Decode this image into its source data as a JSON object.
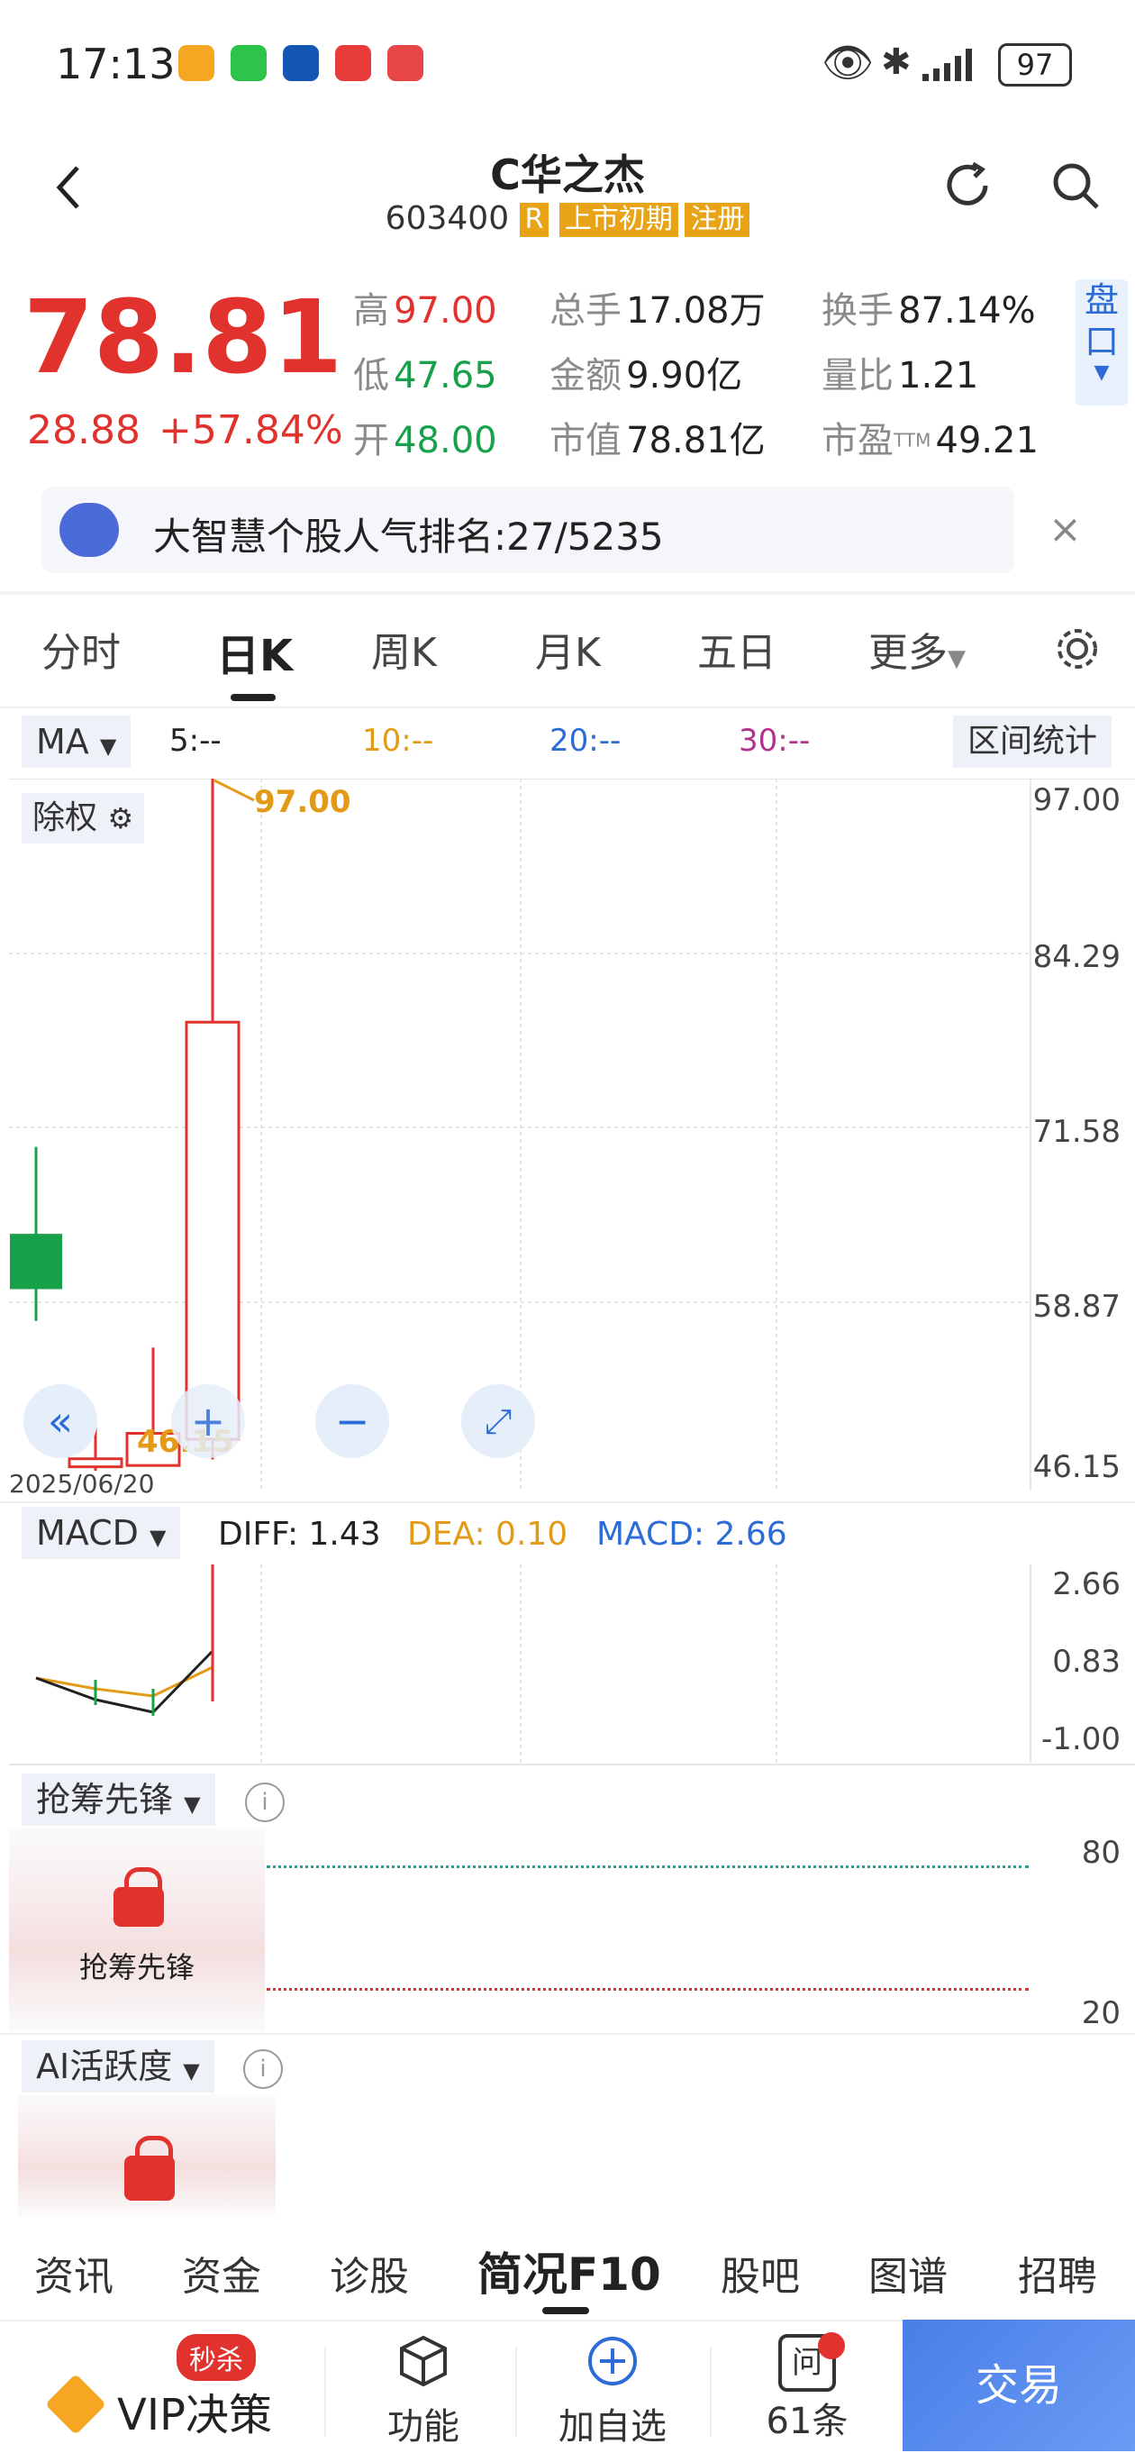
{
  "status_bar": {
    "time": "17:13",
    "battery": "97"
  },
  "header": {
    "title": "C华之杰",
    "code": "603400",
    "tag_r": "R",
    "tag_listing": "上市初期",
    "tag_reg": "注册"
  },
  "quote": {
    "price": "78.81",
    "change": "28.88",
    "change_pct": "+57.84%",
    "high_label": "高",
    "high": "97.00",
    "low_label": "低",
    "low": "47.65",
    "open_label": "开",
    "open": "48.00",
    "vol_label": "总手",
    "vol": "17.08万",
    "amount_label": "金额",
    "amount": "9.90亿",
    "mcap_label": "市值",
    "mcap": "78.81亿",
    "turnover_label": "换手",
    "turnover": "87.14%",
    "vratio_label": "量比",
    "vratio": "1.21",
    "pe_label": "市盈",
    "pe_sup": "TTM",
    "pe": "49.21",
    "panel_btn": "盘口"
  },
  "banner": {
    "text": "大智慧个股人气排名:",
    "rank": "27/5235"
  },
  "tabs": [
    "分时",
    "日K",
    "周K",
    "月K",
    "五日",
    "更多"
  ],
  "ma_bar": {
    "dropdown": "MA",
    "ma5": "5:--",
    "ma10": "10:--",
    "ma20": "20:--",
    "ma30": "30:--",
    "stats_btn": "区间统计"
  },
  "kline": {
    "chip": "除权",
    "high_marker": "97.00",
    "low_marker": "46.15",
    "date": "2025/06/20",
    "y_labels": [
      "97.00",
      "84.29",
      "71.58",
      "58.87",
      "46.15"
    ]
  },
  "macd": {
    "dropdown": "MACD",
    "diff": "DIFF: 1.43",
    "dea": "DEA: 0.10",
    "macd": "MACD: 2.66",
    "y_labels": [
      "2.66",
      "0.83",
      "-1.00"
    ]
  },
  "chip_pioneer": {
    "dropdown": "抢筹先锋",
    "lock_text": "抢筹先锋",
    "y_top": "80",
    "y_bottom": "20"
  },
  "ai_active": {
    "dropdown": "AI活跃度"
  },
  "bottom_tabs": [
    "资讯",
    "资金",
    "诊股",
    "简况F10",
    "股吧",
    "图谱",
    "招聘"
  ],
  "bottom_bar": {
    "vip_badge": "秒杀",
    "vip": "VIP决策",
    "func": "功能",
    "add": "加自选",
    "ask_icon": "问",
    "ask": "61条",
    "trade": "交易"
  },
  "colors": {
    "up": "#e1322d",
    "down": "#16a14a",
    "accent": "#2d6bd6",
    "orange": "#e39a16"
  },
  "candles": [
    {
      "open": 58.87,
      "close": 63.0,
      "high": 69.5,
      "low": 56.5,
      "dir": "down"
    },
    {
      "open": 45.6,
      "close": 46.2,
      "high": 49.0,
      "low": 45.3,
      "dir": "up"
    },
    {
      "open": 45.7,
      "close": 48.1,
      "high": 54.5,
      "low": 45.7,
      "dir": "up"
    },
    {
      "open": 47.65,
      "close": 78.81,
      "high": 97.0,
      "low": 46.15,
      "dir": "up"
    }
  ]
}
